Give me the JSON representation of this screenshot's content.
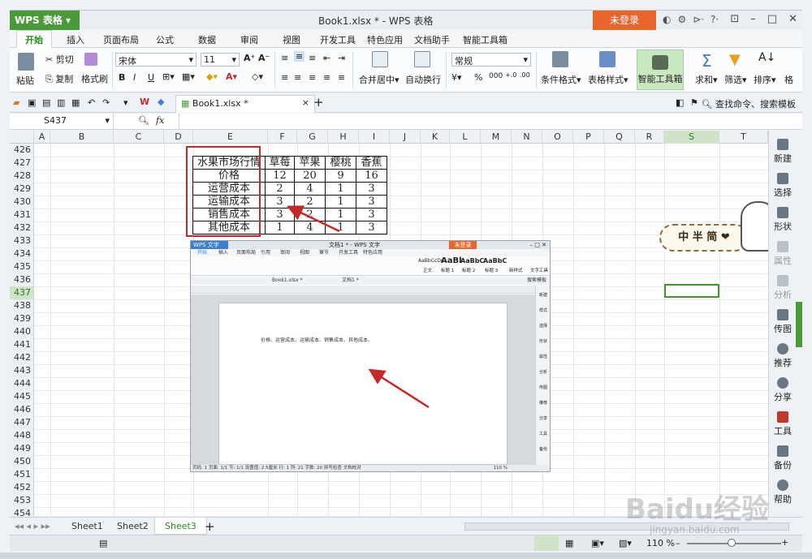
{
  "title_bar": {
    "app_button": "WPS 表格",
    "window_title": "Book1.xlsx * - WPS 表格",
    "login_button": "未登录",
    "help_button": "?·"
  },
  "tabs": [
    "开始",
    "插入",
    "页面布局",
    "公式",
    "数据",
    "审阅",
    "视图",
    "开发工具",
    "特色应用",
    "文档助手",
    "智能工具箱"
  ],
  "ribbon": {
    "paste": "粘贴",
    "cut": "剪切",
    "copy": "复制",
    "format_painter": "格式刷",
    "font_name": "宋体",
    "font_size": "11",
    "grow_font": "A⁺",
    "shrink_font": "A⁻",
    "bold": "B",
    "italic": "I",
    "underline": "U",
    "merge_center": "合并居中",
    "wrap_text": "自动换行",
    "number_format": "常规",
    "percent": "%",
    "comma": "000",
    "conditional_format": "条件格式",
    "table_style": "表格样式",
    "smart_toolbox": "智能工具箱",
    "sum": "求和",
    "filter": "筛选",
    "sort": "排序",
    "format": "格"
  },
  "doc_tab": {
    "name": "Book1.xlsx *",
    "close": "×",
    "add": "+"
  },
  "search_placeholder": "查找命令、搜索模板",
  "name_box": "S437",
  "fx": "fx",
  "columns": [
    "A",
    "B",
    "C",
    "D",
    "E",
    "F",
    "G",
    "H",
    "I",
    "J",
    "K",
    "L",
    "M",
    "N",
    "O",
    "P",
    "Q",
    "R",
    "S",
    "T"
  ],
  "rows": [
    "426",
    "427",
    "428",
    "429",
    "430",
    "431",
    "432",
    "433",
    "434",
    "435",
    "436",
    "437",
    "438",
    "439",
    "440",
    "441",
    "442",
    "443",
    "444",
    "445",
    "446",
    "447",
    "448",
    "449",
    "450",
    "451",
    "452",
    "453",
    "454"
  ],
  "selected_row": "437",
  "selected_column": "S",
  "fruit_table": {
    "header": [
      "水果市场行情",
      "草莓",
      "苹果",
      "樱桃",
      "香蕉"
    ],
    "rows": [
      [
        "价格",
        "12",
        "20",
        "9",
        "16"
      ],
      [
        "运营成本",
        "2",
        "4",
        "1",
        "3"
      ],
      [
        "运输成本",
        "3",
        "2",
        "1",
        "3"
      ],
      [
        "销售成本",
        "3",
        "2",
        "1",
        "3"
      ],
      [
        "其他成本",
        "1",
        "4",
        "1",
        "3"
      ]
    ]
  },
  "embedded": {
    "app_button": "WPS 文字",
    "window_title": "文档1 * - WPS 文字",
    "login_button": "未登录",
    "tabs": [
      "开始",
      "插入",
      "页面布局",
      "引用",
      "审阅",
      "视图",
      "章节",
      "开发工具",
      "特色应用"
    ],
    "doc_tab": "Book1.xlsx *",
    "doc_tab2": "文档1 *",
    "search": "搜索模板",
    "style_samples": [
      "AaBbCcDd",
      "AaBl",
      "AaBbC",
      "AaBbC"
    ],
    "style_names": [
      "正文",
      "标题 1",
      "标题 2",
      "标题 3"
    ],
    "new_style": "新样式",
    "text_tools": "文字工具",
    "body_text": "价格、运营成本、运输成本、销售成本、其他成本、",
    "status": "页码: 1  页面: 1/1  节: 1/1  设置值: 2.5厘米  行: 1  列: 21  字数: 20  拼写检查  文档校对",
    "zoom": "110 %",
    "side_items": [
      "新建",
      "样式",
      "选择",
      "形状",
      "属性",
      "分析",
      "传图",
      "推荐",
      "分享",
      "工具",
      "备份"
    ]
  },
  "right_panel": [
    "新建",
    "选择",
    "形状",
    "属性",
    "分析",
    "传图",
    "推荐",
    "分享",
    "工具",
    "备份",
    "帮助"
  ],
  "sheets": [
    "Sheet1",
    "Sheet2",
    "Sheet3"
  ],
  "active_sheet": "Sheet3",
  "zoom": "110 %",
  "sticker_text": "中 半 简 ❤",
  "watermark": "Baidu经验",
  "watermark_url": "jingyan.baidu.com",
  "colors": {
    "brand_green": "#4b9a3a",
    "login_orange": "#e8662e",
    "annotation_red": "#c62828"
  }
}
